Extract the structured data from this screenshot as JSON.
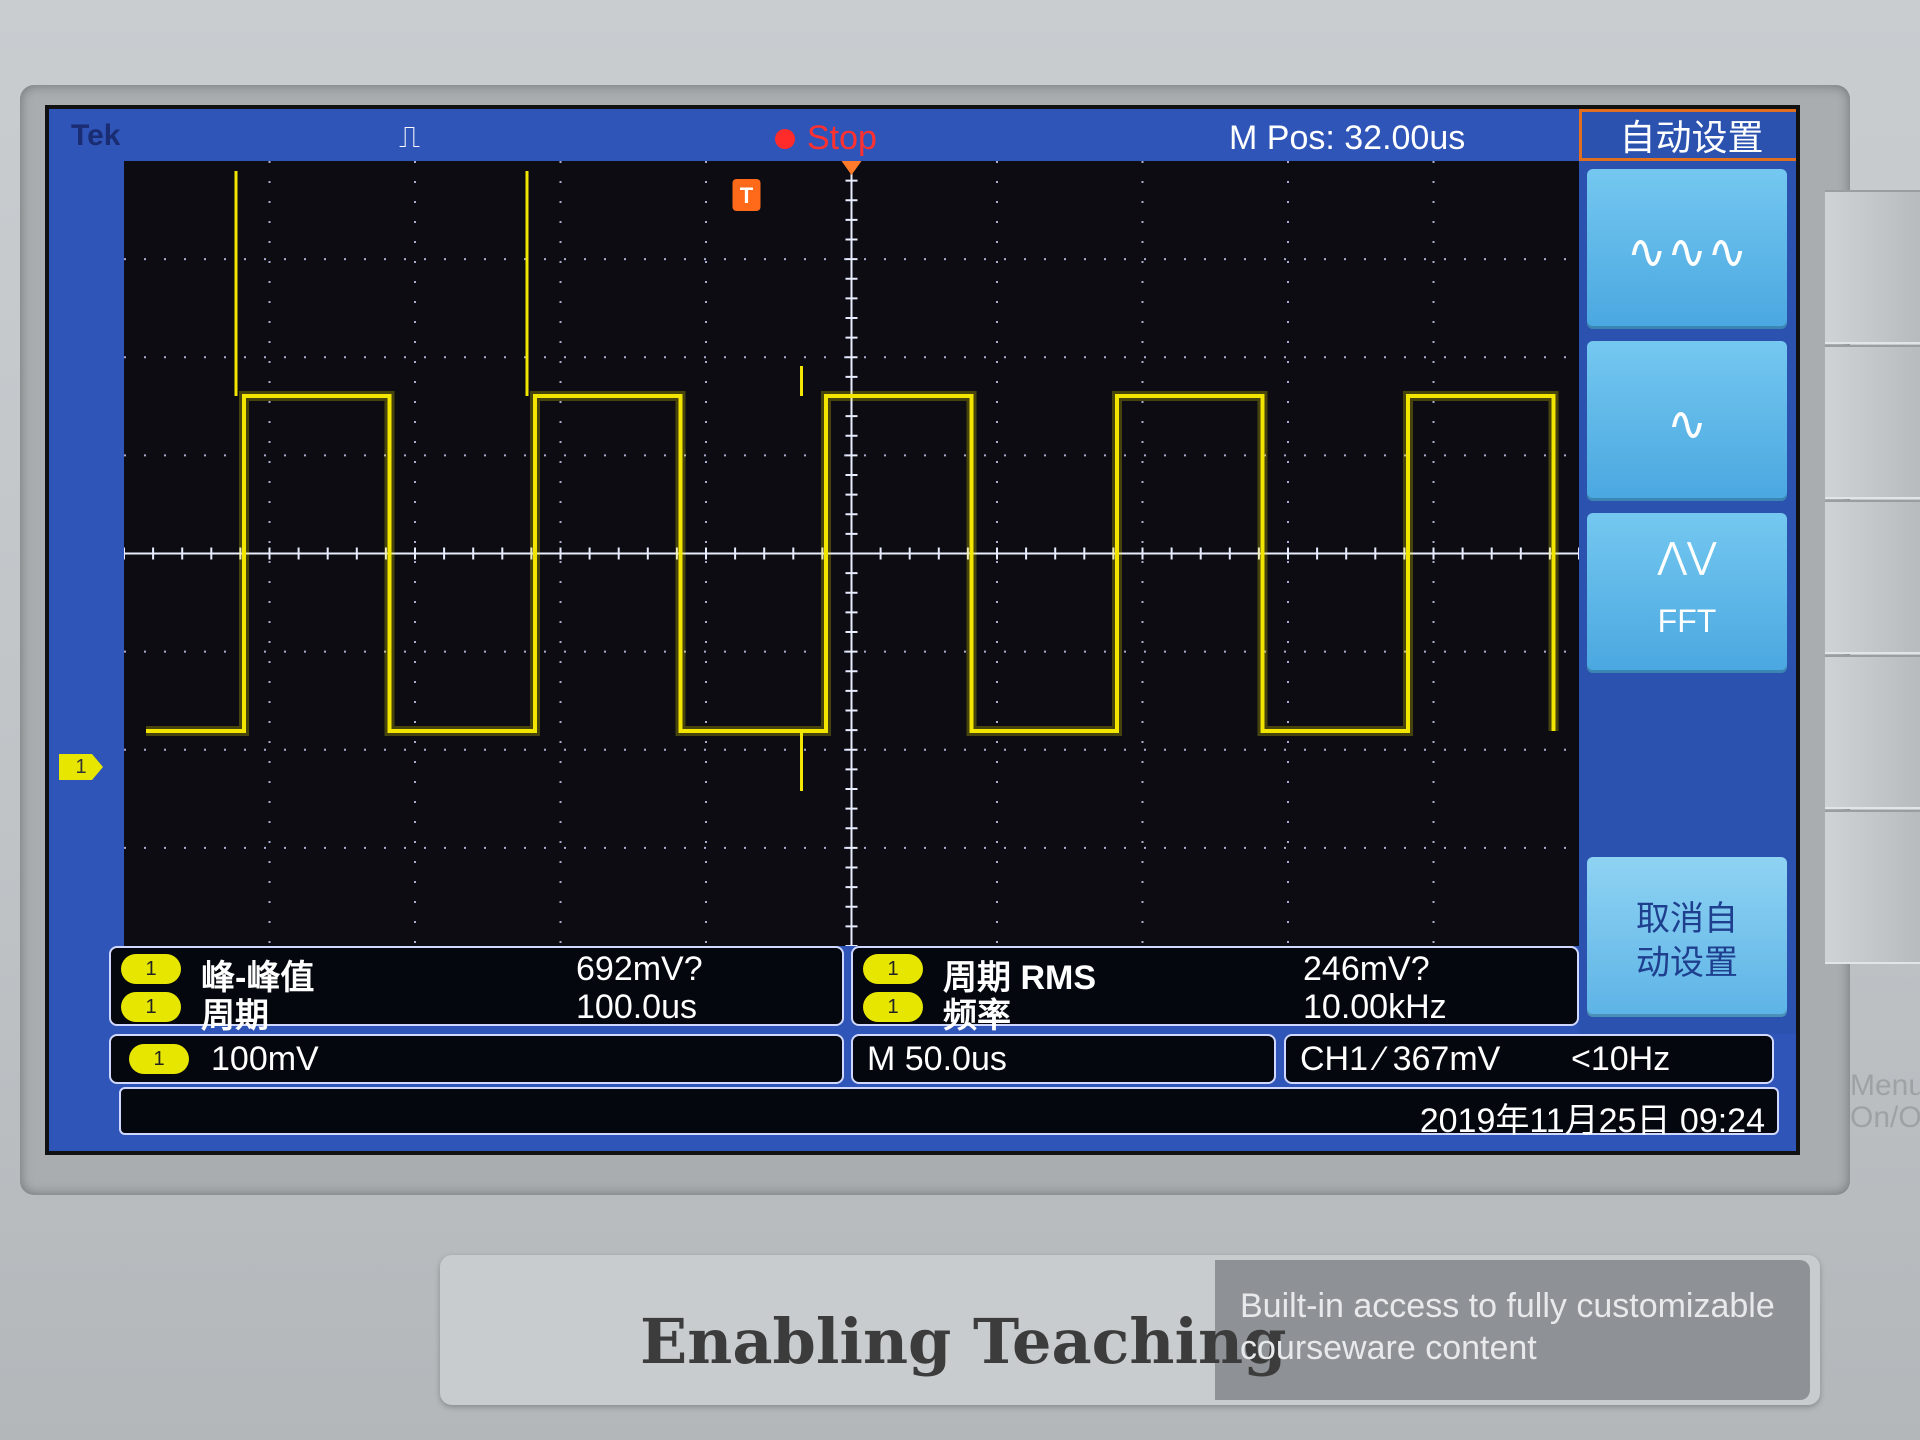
{
  "top_bar": {
    "brand": "Tek",
    "trigger_glyph": "⎍",
    "state": "Stop",
    "main_position": "M Pos: 32.00us"
  },
  "menu": {
    "title": "自动设置",
    "buttons": [
      {
        "label": "",
        "icon": "multi-cycle-wave-icon",
        "glyph": "∿∿∿"
      },
      {
        "label": "",
        "icon": "single-cycle-wave-icon",
        "glyph": "∿"
      },
      {
        "label": "FFT",
        "icon": "fft-icon",
        "glyph": "⋀⋁"
      },
      {
        "label": "取消自动设置",
        "icon": "",
        "glyph": ""
      }
    ],
    "cancel_line1": "取消自",
    "cancel_line2": "动设置"
  },
  "trigger_marker": "T",
  "channel_marker": "1",
  "measurements": {
    "left": [
      {
        "channel": "1",
        "label": "峰-峰值",
        "value": "692mV?"
      },
      {
        "channel": "1",
        "label": "周期",
        "value": "100.0us"
      }
    ],
    "right": [
      {
        "channel": "1",
        "label": "周期 RMS",
        "value": "246mV?"
      },
      {
        "channel": "1",
        "label": "频率",
        "value": "10.00kHz"
      }
    ]
  },
  "status": {
    "ch1_scale": "100mV",
    "ch1_badge": "1",
    "timebase": "M 50.0us",
    "trigger": "CH1 ⁄ 367mV",
    "trigger_freq": "<10Hz",
    "datetime": "2019年11月25日 09:24"
  },
  "branding": {
    "title": "Enabling Teaching",
    "tagline_line1": "Built-in access to fully customizable",
    "tagline_line2": "courseware content",
    "side_label_1": "Menu",
    "side_label_2": "On/O"
  },
  "waveform": {
    "type": "square",
    "period_us": 100.0,
    "frequency_khz": 10.0,
    "peak_to_peak_mv": 692,
    "cycles_visible": 4.8,
    "color": "#f2e600"
  },
  "colors": {
    "screen_bg": "#2f55b8",
    "trace": "#f2e600",
    "stop": "#ff3030",
    "menu_button": "#4aa7e0",
    "accent_orange": "#e07020"
  }
}
